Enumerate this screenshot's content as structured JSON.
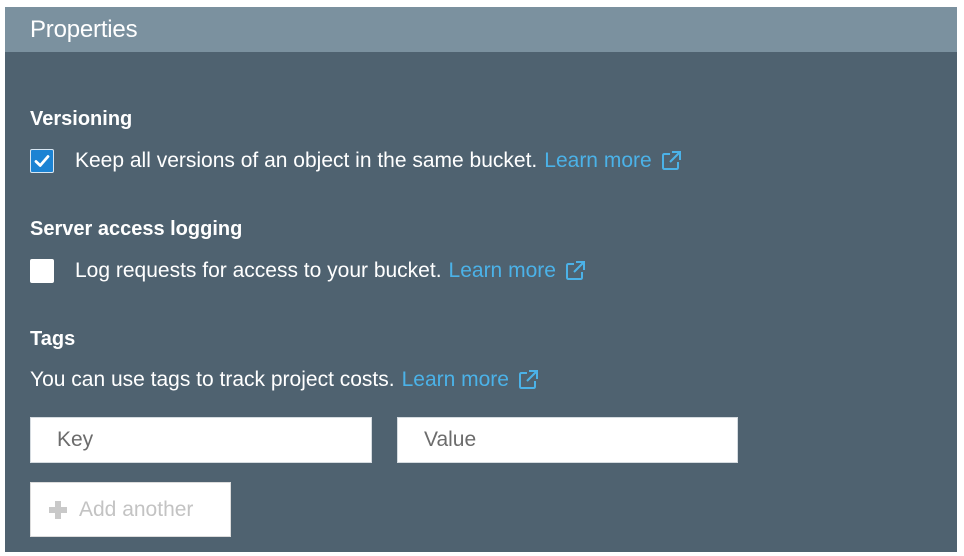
{
  "panel": {
    "title": "Properties"
  },
  "versioning": {
    "title": "Versioning",
    "checked": true,
    "description": "Keep all versions of an object in the same bucket.",
    "link_label": "Learn more",
    "link_icon": "external-link-icon"
  },
  "logging": {
    "title": "Server access logging",
    "checked": false,
    "description": "Log requests for access to your bucket.",
    "link_label": "Learn more",
    "link_icon": "external-link-icon"
  },
  "tags": {
    "title": "Tags",
    "description": "You can use tags to track project costs.",
    "link_label": "Learn more",
    "link_icon": "external-link-icon",
    "key_placeholder": "Key",
    "value_placeholder": "Value",
    "key_value": "",
    "value_value": "",
    "add_label": "Add another",
    "add_icon": "plus-icon"
  },
  "colors": {
    "panel_background": "#4f6270",
    "header_background": "#7b919f",
    "link": "#4bb2e8",
    "checkbox_checked": "#1c83d3"
  }
}
